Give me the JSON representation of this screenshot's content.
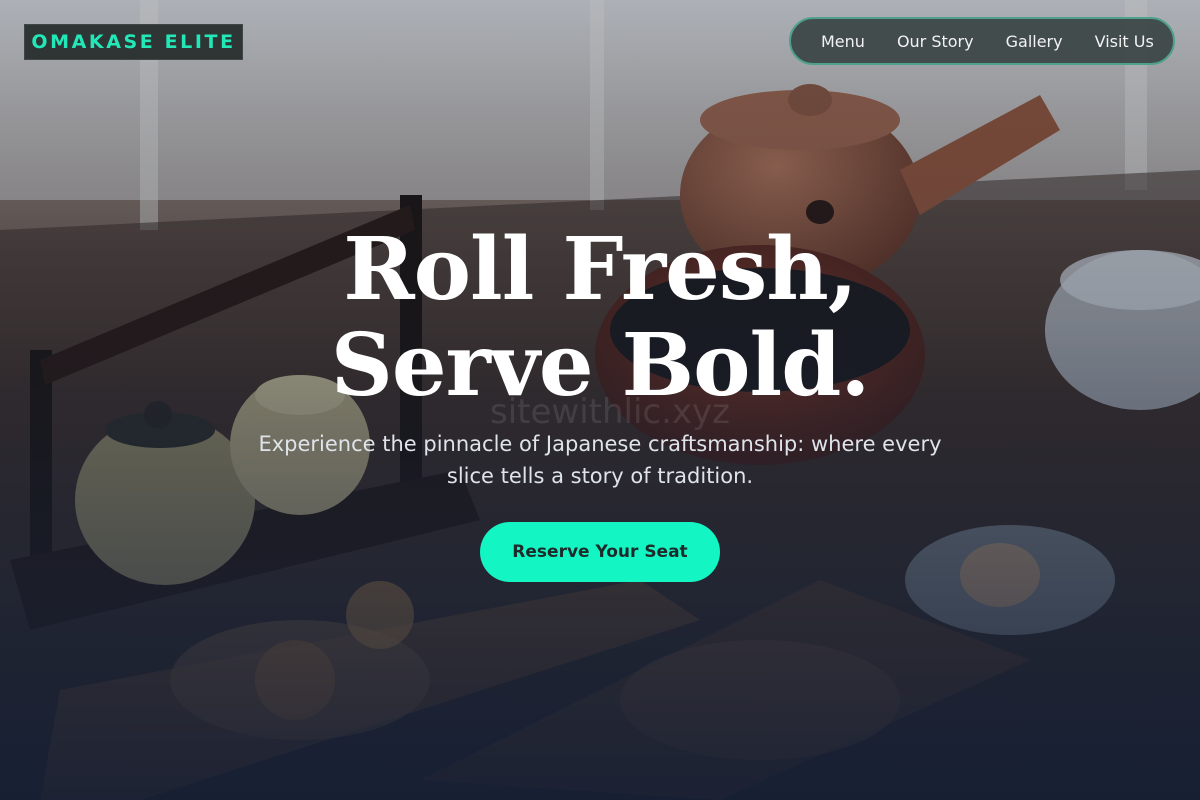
{
  "brand": {
    "logo_text": "OMAKASE ELITE",
    "accent_color": "#14f5c4"
  },
  "nav": {
    "items": [
      {
        "label": "Menu"
      },
      {
        "label": "Our Story"
      },
      {
        "label": "Gallery"
      },
      {
        "label": "Visit Us"
      }
    ]
  },
  "hero": {
    "headline_line1": "Roll Fresh,",
    "headline_line2": "Serve Bold.",
    "subheadline": "Experience the pinnacle of Japanese craftsmanship: where every slice tells a story of tradition.",
    "cta_label": "Reserve Your Seat",
    "watermark": "sitewithlic.xyz",
    "background_image": "japanese-tea-set-and-bento-photo"
  }
}
